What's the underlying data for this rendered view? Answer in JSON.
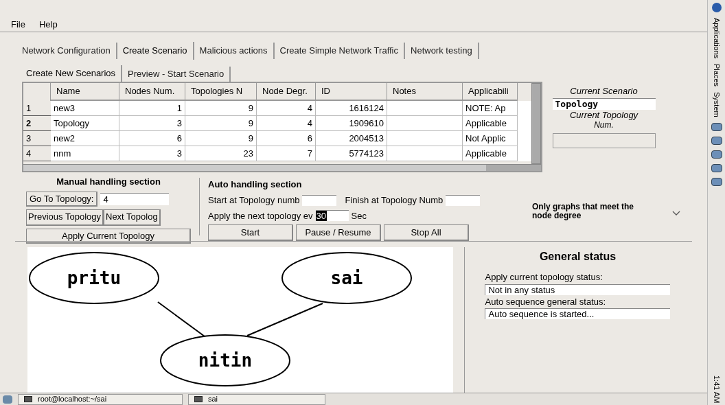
{
  "menu": [
    "File",
    "Help"
  ],
  "tabs": [
    {
      "label": "Network Configuration",
      "selected": false
    },
    {
      "label": "Create Scenario",
      "selected": true
    },
    {
      "label": "Malicious actions",
      "selected": false
    },
    {
      "label": "Create Simple Network Traffic",
      "selected": false
    },
    {
      "label": "Network testing",
      "selected": false
    }
  ],
  "subtabs": [
    {
      "label": "Create New Scenarios",
      "selected": true
    },
    {
      "label": "Preview - Start Scenario",
      "selected": false
    }
  ],
  "table": {
    "columns": [
      "Name",
      "Nodes Num.",
      "Topologies N",
      "Node Degr.",
      "ID",
      "Notes",
      "Applicabili"
    ],
    "rows": [
      {
        "index": "1",
        "selected": false,
        "cells": [
          "new3",
          "1",
          "9",
          "4",
          "1616124",
          "",
          "NOTE: Ap"
        ]
      },
      {
        "index": "2",
        "selected": true,
        "cells": [
          "Topology",
          "3",
          "9",
          "4",
          "1909610",
          "",
          "Applicable"
        ]
      },
      {
        "index": "3",
        "selected": false,
        "cells": [
          "new2",
          "6",
          "9",
          "6",
          "2004513",
          "",
          "Not Applic"
        ]
      },
      {
        "index": "4",
        "selected": false,
        "cells": [
          "nnm",
          "3",
          "23",
          "7",
          "5774123",
          "",
          "Applicable"
        ]
      }
    ]
  },
  "current": {
    "scenario_label": "Current Scenario",
    "scenario_value": "Topology",
    "topology_label": "Current Topology",
    "topology_label_2": "Num."
  },
  "manual": {
    "title": "Manual handling section",
    "goto_button": "Go To Topology:",
    "goto_value": "4",
    "previous_button": "Previous Topology",
    "next_button": "Next Topolog",
    "apply_button": "Apply Current Topology"
  },
  "auto": {
    "title": "Auto handling section",
    "start_label": "Start at Topology numb",
    "finish_label": "Finish at Topology Numb",
    "apply_label": "Apply the next topology ev",
    "interval": "30",
    "unit": "Sec",
    "buttons": [
      "Start",
      "Pause / Resume",
      "Stop All"
    ]
  },
  "filter": {
    "label": "Only graphs that meet the node degree"
  },
  "graph": {
    "nodes": [
      {
        "label": "pritu"
      },
      {
        "label": "sai"
      },
      {
        "label": "nitin"
      }
    ]
  },
  "status": {
    "title": "General status",
    "apply_label": "Apply current topology status:",
    "apply_value": "Not in any status",
    "auto_label": "Auto sequence general status:",
    "auto_value": "Auto sequence is started..."
  },
  "taskbar": [
    "root@localhost:~/sai",
    "sai"
  ],
  "side_panel": {
    "items": [
      "Applications",
      "Places",
      "System"
    ],
    "clock": "1:41 AM"
  }
}
